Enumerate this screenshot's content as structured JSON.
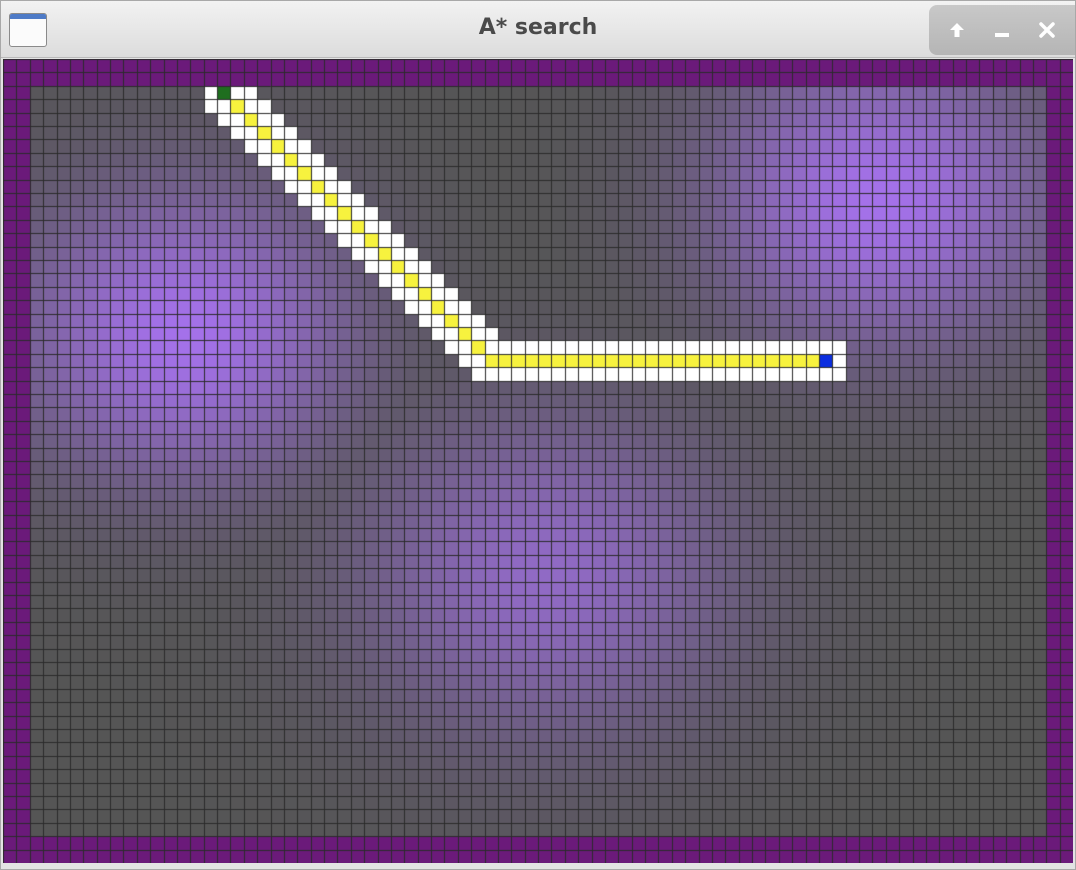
{
  "window": {
    "title": "A* search",
    "icon": "app-window-icon",
    "controls": [
      {
        "name": "maximize-button",
        "icon": "arrow-up-icon"
      },
      {
        "name": "minimize-button",
        "icon": "minimize-icon"
      },
      {
        "name": "close-button",
        "icon": "close-icon"
      }
    ]
  },
  "grid": {
    "columns": 80,
    "rows": 60,
    "start_cell": [
      16,
      2
    ],
    "goal_cell": [
      61,
      22
    ],
    "path_cells": [
      [
        16,
        2
      ],
      [
        17,
        3
      ],
      [
        18,
        4
      ],
      [
        19,
        5
      ],
      [
        20,
        6
      ],
      [
        21,
        7
      ],
      [
        22,
        8
      ],
      [
        23,
        9
      ],
      [
        24,
        10
      ],
      [
        25,
        11
      ],
      [
        26,
        12
      ],
      [
        27,
        13
      ],
      [
        28,
        14
      ],
      [
        29,
        15
      ],
      [
        30,
        16
      ],
      [
        31,
        17
      ],
      [
        32,
        18
      ],
      [
        33,
        19
      ],
      [
        34,
        20
      ],
      [
        35,
        21
      ],
      [
        36,
        22
      ],
      [
        37,
        22
      ],
      [
        38,
        22
      ],
      [
        39,
        22
      ],
      [
        40,
        22
      ],
      [
        41,
        22
      ],
      [
        42,
        22
      ],
      [
        43,
        22
      ],
      [
        44,
        22
      ],
      [
        45,
        22
      ],
      [
        46,
        22
      ],
      [
        47,
        22
      ],
      [
        48,
        22
      ],
      [
        49,
        22
      ],
      [
        50,
        22
      ],
      [
        51,
        22
      ],
      [
        52,
        22
      ],
      [
        53,
        22
      ],
      [
        54,
        22
      ],
      [
        55,
        22
      ],
      [
        56,
        22
      ],
      [
        57,
        22
      ],
      [
        58,
        22
      ],
      [
        59,
        22
      ],
      [
        60,
        22
      ],
      [
        61,
        22
      ]
    ],
    "colors": {
      "wall": "#6b1a7a",
      "unvisited": "#555555",
      "explored_light": "#a471ea",
      "open_set": "#ffffff",
      "path": "#f7f23e",
      "start": "#1f6e1f",
      "goal": "#0b2ee0",
      "grid_line": "#2a2a2a"
    }
  }
}
